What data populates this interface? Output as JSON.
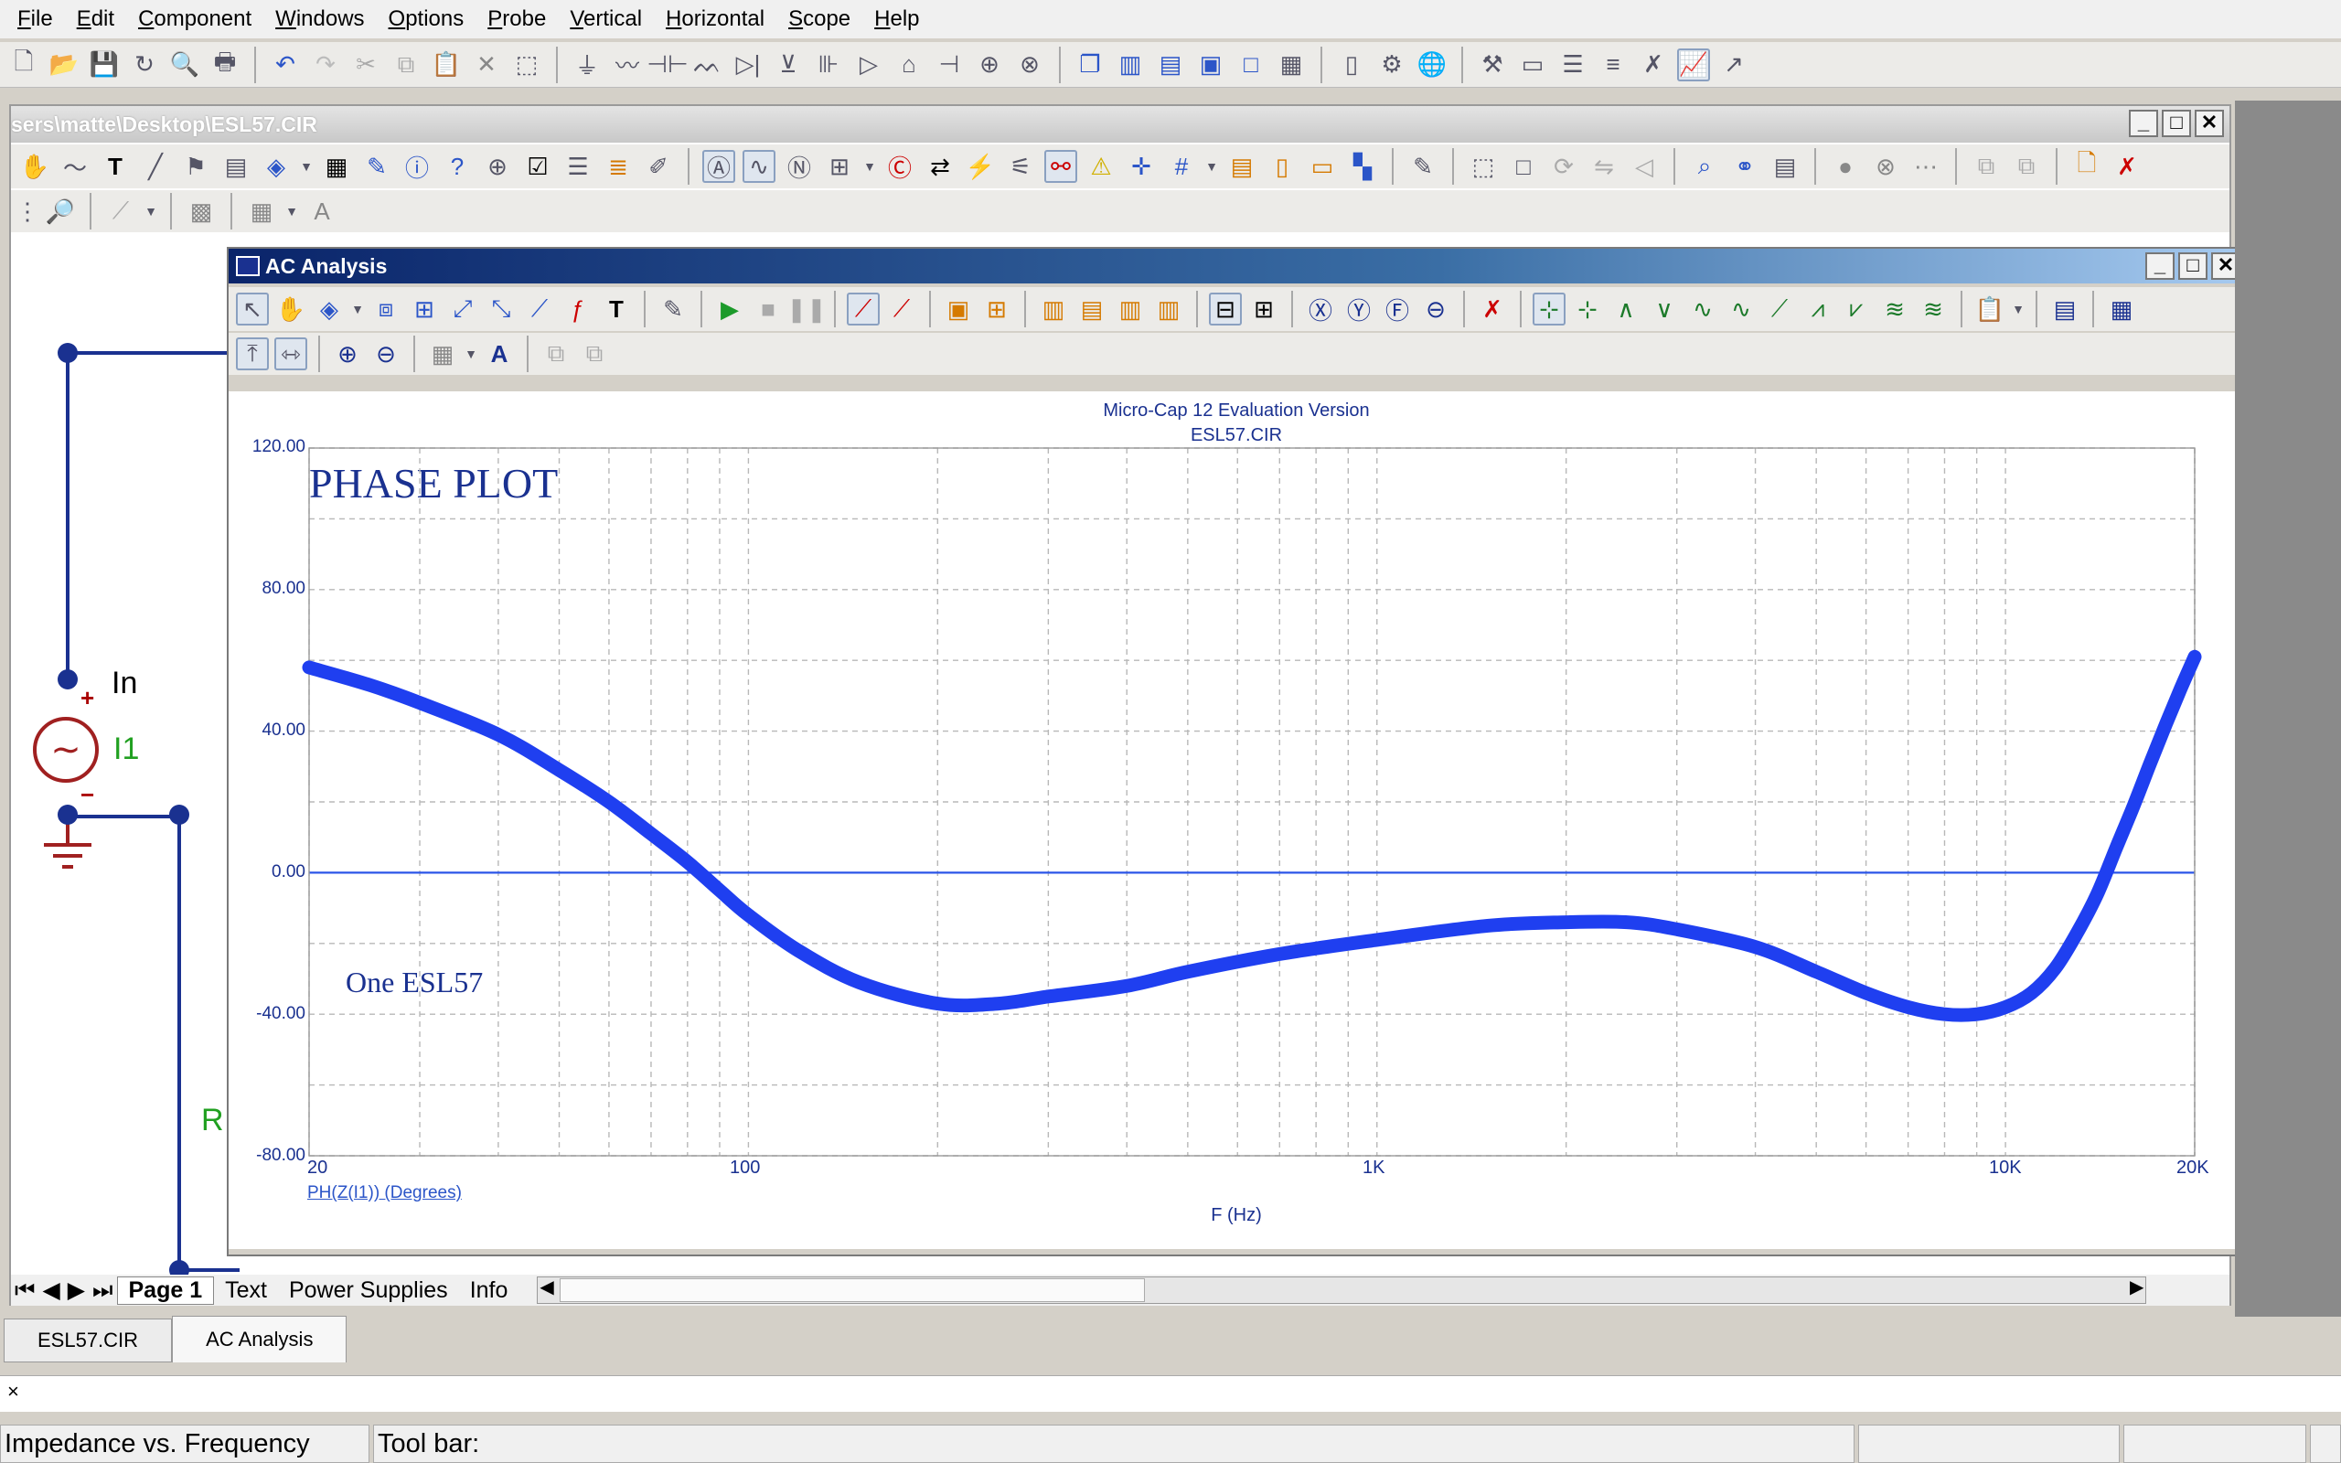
{
  "menu": [
    "File",
    "Edit",
    "Component",
    "Windows",
    "Options",
    "Probe",
    "Vertical",
    "Horizontal",
    "Scope",
    "Help"
  ],
  "schematic_window": {
    "title": "sers\\matte\\Desktop\\ESL57.CIR",
    "labels": {
      "node_in": "In",
      "source": "I1",
      "resistor_partial": "R",
      "plus": "+",
      "minus": "−"
    }
  },
  "analysis_window": {
    "title": "AC Analysis"
  },
  "plot": {
    "header_line1": "Micro-Cap 12 Evaluation Version",
    "header_line2": "ESL57.CIR",
    "annotation_title": "PHASE PLOT",
    "annotation_label": "One ESL57",
    "trace_label": "PH(Z(I1)) (Degrees)",
    "x_label": "F (Hz)",
    "y_ticks": [
      "120.00",
      "80.00",
      "40.00",
      "0.00",
      "-40.00",
      "-80.00"
    ],
    "x_ticks": [
      "20",
      "100",
      "1K",
      "10K",
      "20K"
    ]
  },
  "chart_data": {
    "type": "line",
    "title": "Micro-Cap 12 Evaluation Version",
    "subtitle": "ESL57.CIR",
    "xlabel": "F (Hz)",
    "ylabel": "PH(Z(I1)) (Degrees)",
    "x_scale": "log",
    "xlim": [
      20,
      20000
    ],
    "ylim": [
      -80,
      120
    ],
    "grid": true,
    "series": [
      {
        "name": "PH(Z(I1)) (Degrees)",
        "color": "#1f3ff0",
        "x": [
          20,
          25,
          30,
          40,
          50,
          60,
          70,
          80,
          90,
          100,
          120,
          150,
          200,
          250,
          300,
          400,
          500,
          700,
          1000,
          1500,
          2000,
          2500,
          3000,
          4000,
          5000,
          6000,
          7000,
          8000,
          9000,
          10000,
          11000,
          12000,
          13000,
          14000,
          15000,
          16000,
          17000,
          18000,
          19000,
          20000
        ],
        "y": [
          58,
          53,
          48,
          39,
          29,
          20,
          11,
          3,
          -5,
          -12,
          -22,
          -31,
          -37,
          -37,
          -35,
          -32,
          -28,
          -23,
          -19,
          -15,
          -14,
          -14,
          -16,
          -21,
          -28,
          -34,
          -38,
          -40,
          -40,
          -38,
          -34,
          -27,
          -17,
          -6,
          7,
          19,
          31,
          42,
          52,
          61
        ]
      }
    ]
  },
  "sheet_tabs": [
    "Page 1",
    "Text",
    "Power Supplies",
    "Info"
  ],
  "bottom_tabs": [
    "ESL57.CIR",
    "AC Analysis"
  ],
  "status": {
    "left": "Impedance vs. Frequency",
    "toolbar": "Tool bar:",
    "close": "×"
  },
  "icon_bold_text": {
    "text_tool": "T",
    "font_tool": "A"
  }
}
